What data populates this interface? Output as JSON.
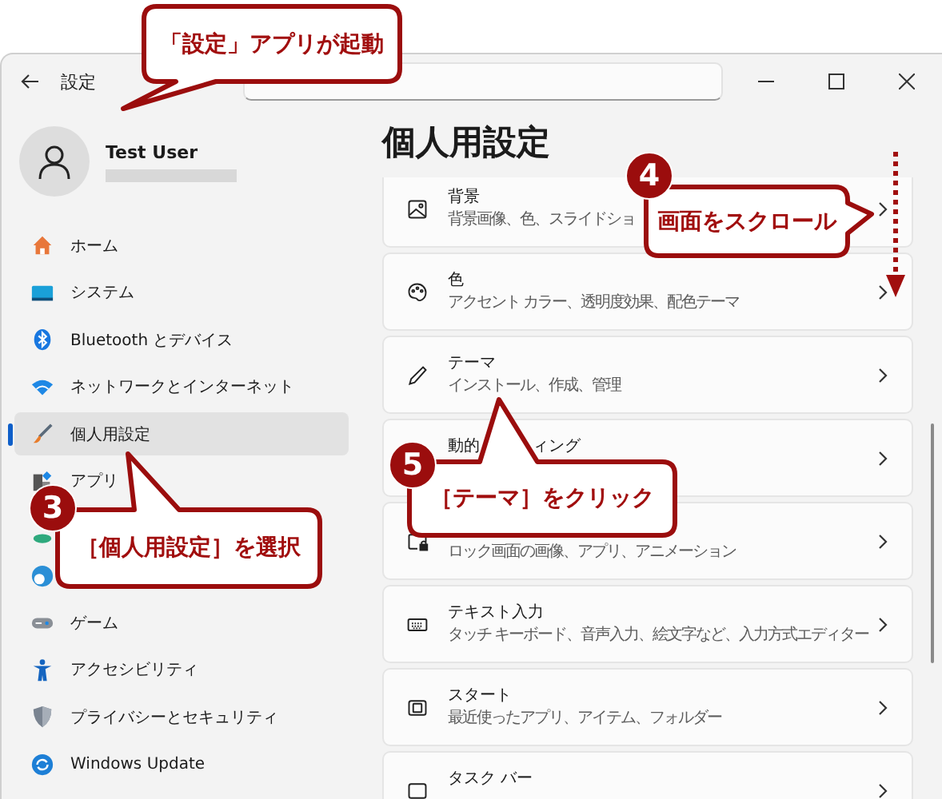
{
  "window": {
    "title": "設定"
  },
  "user": {
    "name": "Test User"
  },
  "sidebar": {
    "items": [
      {
        "kind": "home",
        "label": "ホーム",
        "selected": false
      },
      {
        "kind": "system",
        "label": "システム",
        "selected": false
      },
      {
        "kind": "bluetooth",
        "label": "Bluetooth とデバイス",
        "selected": false
      },
      {
        "kind": "network",
        "label": "ネットワークとインターネット",
        "selected": false
      },
      {
        "kind": "brush",
        "label": "個人用設定",
        "selected": true
      },
      {
        "kind": "apps",
        "label": "アプリ",
        "selected": false
      },
      {
        "kind": "account"
      },
      {
        "kind": "time"
      },
      {
        "kind": "gaming",
        "label": "ゲーム",
        "selected": false
      },
      {
        "kind": "accessibility",
        "label": "アクセシビリティ",
        "selected": false
      },
      {
        "kind": "shield",
        "label": "プライバシーとセキュリティ",
        "selected": false
      },
      {
        "kind": "update",
        "label": "Windows Update",
        "selected": false
      }
    ]
  },
  "page": {
    "title": "個人用設定",
    "cards": [
      {
        "kind": "picture",
        "title": "背景",
        "subtitle": "背景画像、色、スライドショ"
      },
      {
        "kind": "palette",
        "title": "色",
        "subtitle": "アクセント カラー、透明度効果、配色テーマ"
      },
      {
        "kind": "pen",
        "title": "テーマ",
        "subtitle": "インストール、作成、管理"
      },
      {
        "kind": "light",
        "title": "動的",
        "title_end": "ィング"
      },
      {
        "kind": "lock",
        "subtitle": "ロック画面の画像、アプリ、アニメーション"
      },
      {
        "kind": "keyboard",
        "title": "テキスト入力",
        "subtitle": "タッチ キーボード、音声入力、絵文字など、入力方式エディター"
      },
      {
        "kind": "start",
        "title": "スタート",
        "subtitle": "最近使ったアプリ、アイテム、フォルダー"
      },
      {
        "kind": "taskbar",
        "title": "タスク バー"
      }
    ]
  },
  "callouts": [
    {
      "text": "「設定」アプリが起動"
    },
    {
      "step": "4",
      "text": "画面をスクロール"
    },
    {
      "step": "3",
      "text": "［個人用設定］を選択"
    },
    {
      "step": "5",
      "text": "［テーマ］をクリック"
    }
  ]
}
